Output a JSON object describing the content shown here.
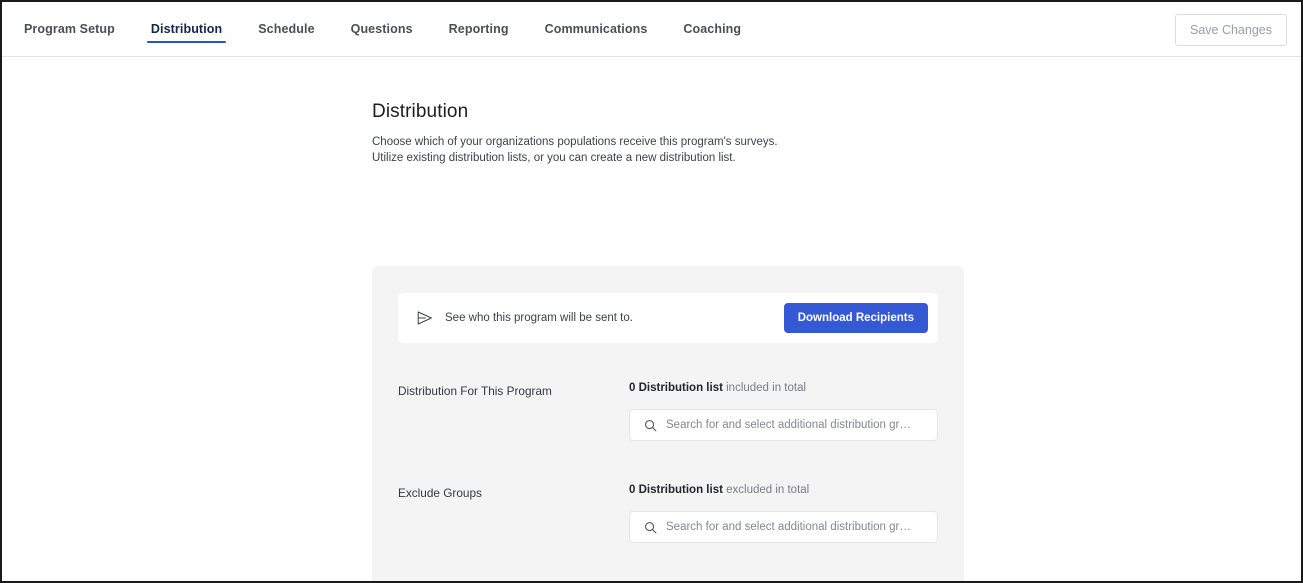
{
  "header": {
    "tabs": [
      {
        "label": "Program Setup",
        "active": false
      },
      {
        "label": "Distribution",
        "active": true
      },
      {
        "label": "Schedule",
        "active": false
      },
      {
        "label": "Questions",
        "active": false
      },
      {
        "label": "Reporting",
        "active": false
      },
      {
        "label": "Communications",
        "active": false
      },
      {
        "label": "Coaching",
        "active": false
      }
    ],
    "save_label": "Save Changes",
    "active_tab_color": "#2259be"
  },
  "page": {
    "title": "Distribution",
    "description_line1": "Choose which of your organizations populations receive this program's surveys.",
    "description_line2": "Utilize existing distribution lists, or you can create a new distribution list."
  },
  "recipients": {
    "text": "See who this program will be sent to.",
    "button_label": "Download Recipients",
    "button_color": "#3558d4"
  },
  "rows": [
    {
      "label": "Distribution For This Program",
      "summary_count": "0 Distribution list",
      "summary_rest": " included in total",
      "search_placeholder": "Search for and select additional distribution gr…",
      "search_value": ""
    },
    {
      "label": "Exclude Groups",
      "summary_count": "0 Distribution list",
      "summary_rest": " excluded in total",
      "search_placeholder": "Search for and select additional distribution gr…",
      "search_value": ""
    }
  ]
}
